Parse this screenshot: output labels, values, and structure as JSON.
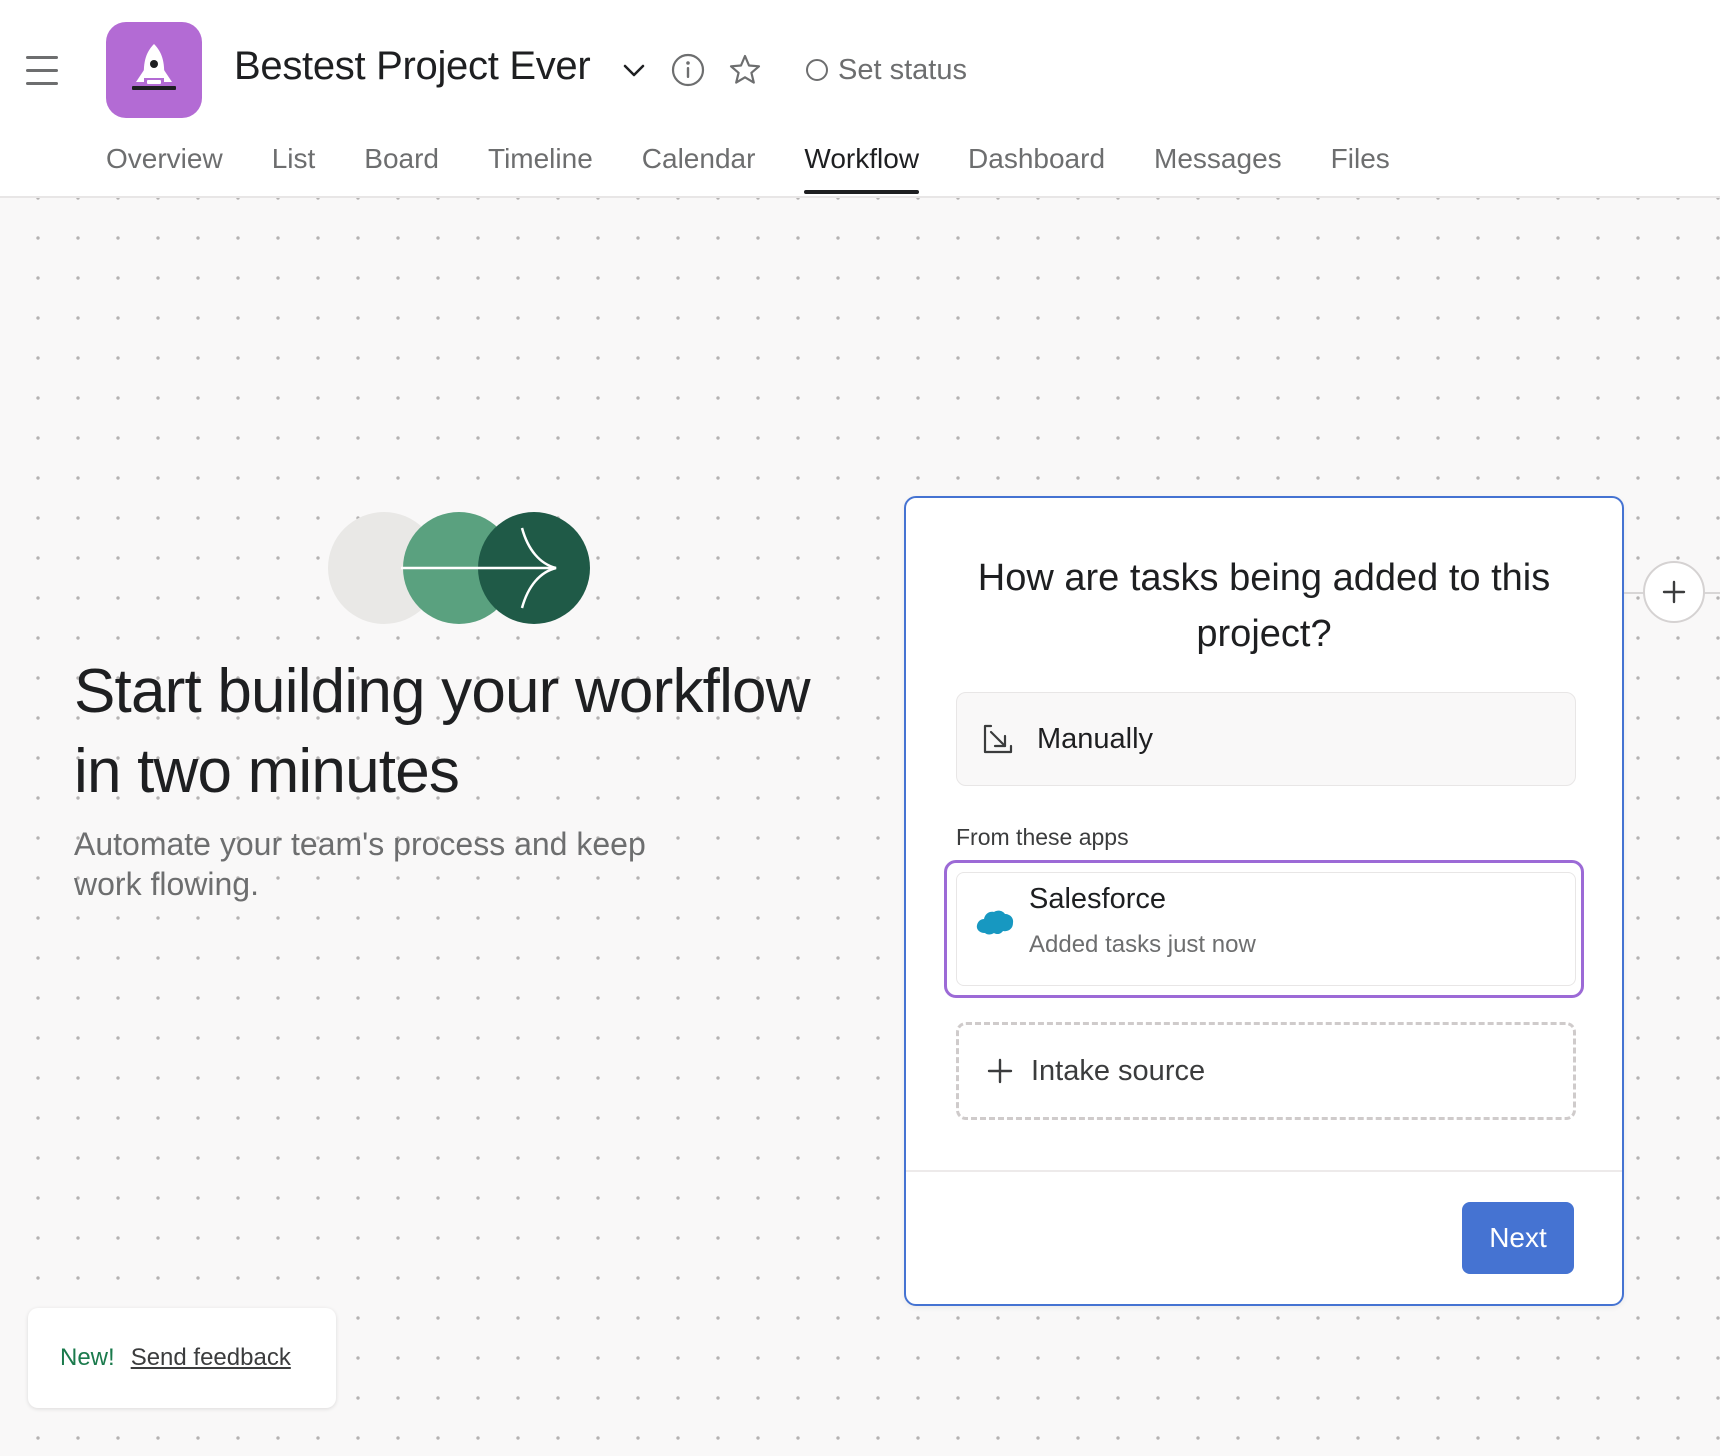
{
  "header": {
    "project_title": "Bestest Project Ever",
    "set_status": "Set status",
    "app_icon": "rocket-icon",
    "app_icon_color": "#b36bd4"
  },
  "tabs": [
    {
      "label": "Overview",
      "active": false
    },
    {
      "label": "List",
      "active": false
    },
    {
      "label": "Board",
      "active": false
    },
    {
      "label": "Timeline",
      "active": false
    },
    {
      "label": "Calendar",
      "active": false
    },
    {
      "label": "Workflow",
      "active": true
    },
    {
      "label": "Dashboard",
      "active": false
    },
    {
      "label": "Messages",
      "active": false
    },
    {
      "label": "Files",
      "active": false
    }
  ],
  "hero": {
    "title": "Start building your workflow in two minutes",
    "subtitle": "Automate your team's process and keep work flowing."
  },
  "card": {
    "question": "How are tasks being added to this project?",
    "manual_option": "Manually",
    "apps_label": "From these apps",
    "app_option": {
      "name": "Salesforce",
      "status": "Added tasks just now"
    },
    "intake_option": "Intake source",
    "next_label": "Next"
  },
  "feedback": {
    "badge": "New!",
    "link": "Send feedback"
  },
  "colors": {
    "accent_blue": "#4573d2",
    "selection_purple": "#9c6ad6",
    "feedback_green": "#1a7a4c",
    "hero_green_light": "#5aa17f",
    "hero_green_dark": "#1f5a47"
  }
}
